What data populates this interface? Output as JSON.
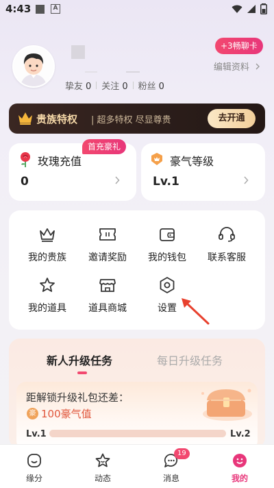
{
  "status_bar": {
    "time": "4:43",
    "notif_icon_letter": "A"
  },
  "profile": {
    "chat_badge": "+3畅聊卡",
    "edit_profile": "编辑资料",
    "stats": [
      {
        "label": "挚友",
        "value": "0"
      },
      {
        "label": "关注",
        "value": "0"
      },
      {
        "label": "粉丝",
        "value": "0"
      }
    ]
  },
  "noble": {
    "title": "贵族特权",
    "subtitle": "| 超多特权 尽显尊贵",
    "button": "去开通"
  },
  "rose": {
    "badge": "首充豪礼",
    "title": "玫瑰充值",
    "value": "0"
  },
  "rich": {
    "title": "豪气等级",
    "value": "Lv.1"
  },
  "menu": {
    "items": [
      {
        "label": "我的贵族",
        "icon": "crown-icon"
      },
      {
        "label": "邀请奖励",
        "icon": "ticket-icon"
      },
      {
        "label": "我的钱包",
        "icon": "wallet-icon"
      },
      {
        "label": "联系客服",
        "icon": "headset-icon"
      },
      {
        "label": "我的道具",
        "icon": "star-icon"
      },
      {
        "label": "道具商城",
        "icon": "shop-icon"
      },
      {
        "label": "设置",
        "icon": "settings-icon"
      }
    ]
  },
  "tasks": {
    "tab_new": "新人升级任务",
    "tab_daily": "每日升级任务",
    "gift_text": "距解锁升级礼包还差：",
    "hao_badge": "豪",
    "gift_amount": "100豪气值",
    "lv_start": "Lv.1",
    "lv_end": "Lv.2",
    "progress": 0
  },
  "nav": {
    "items": [
      {
        "label": "缘分",
        "icon": "fate-icon"
      },
      {
        "label": "动态",
        "icon": "moments-icon"
      },
      {
        "label": "消息",
        "icon": "message-icon"
      },
      {
        "label": "我的",
        "icon": "me-icon"
      }
    ],
    "message_badge": "19"
  },
  "colors": {
    "accent": "#e8367a",
    "gold": "#f5d8a8"
  }
}
